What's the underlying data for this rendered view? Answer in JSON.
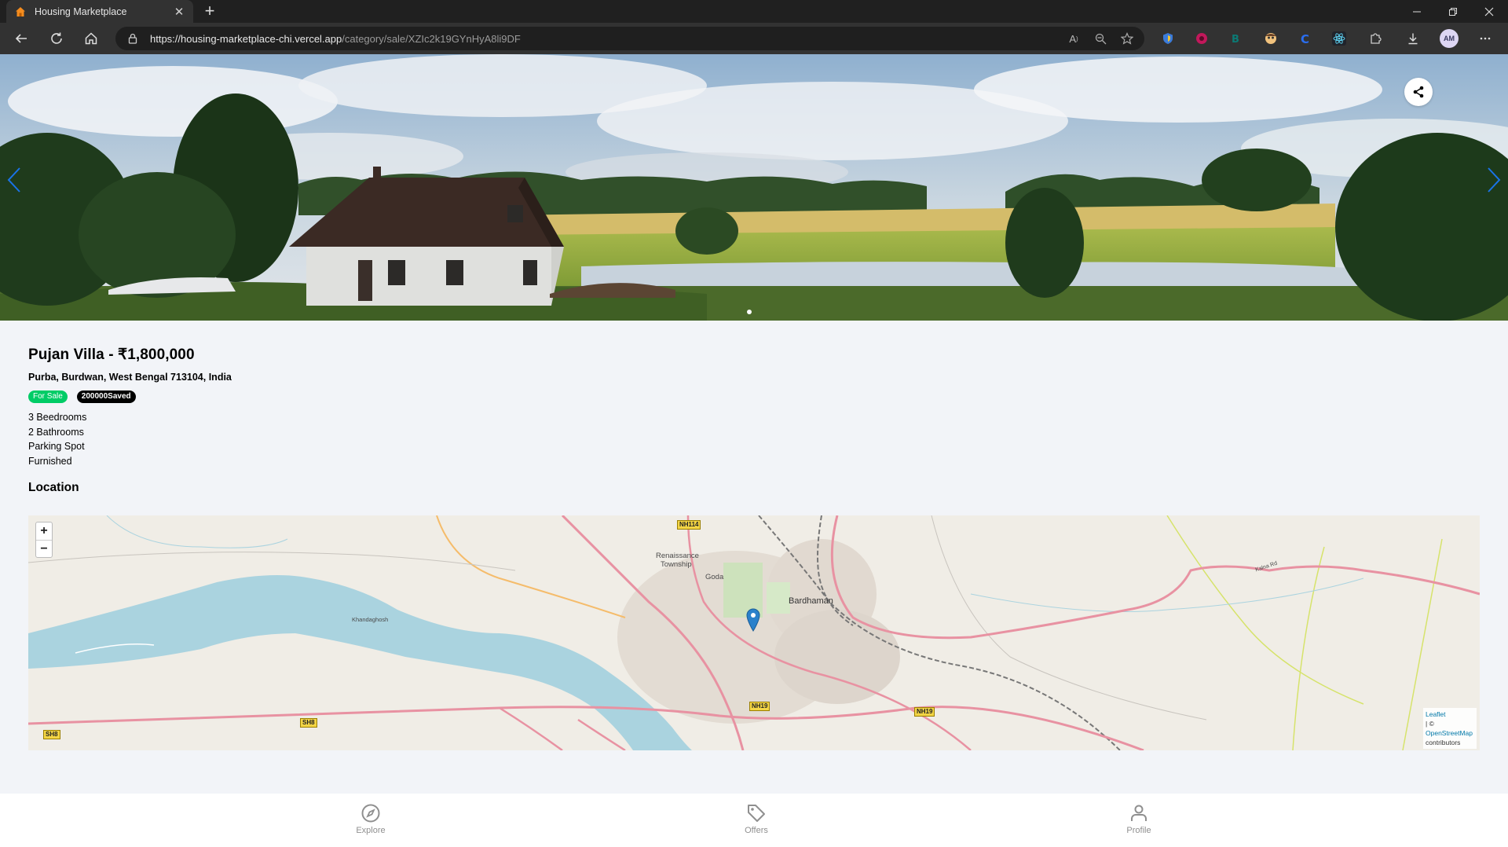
{
  "browser": {
    "tab_title": "Housing Marketplace",
    "url_host": "https://housing-marketplace-chi.vercel.app",
    "url_path": "/category/sale/XZIc2k19GYnHyA8li9DF",
    "profile_initials": "AM"
  },
  "listing": {
    "title": "Pujan Villa - ₹1,800,000",
    "address": "Purba, Burdwan, West Bengal 713104, India",
    "badge_type": "For Sale",
    "badge_saved": "200000Saved",
    "features": [
      "3 Beedrooms",
      "2 Bathrooms",
      "Parking Spot",
      "Furnished"
    ],
    "location_heading": "Location"
  },
  "map": {
    "zoom_in": "+",
    "zoom_out": "−",
    "labels": {
      "renaissance": "Renaissance",
      "township": "Township",
      "goda": "Goda",
      "bardhaman": "Bardhaman",
      "khandaghosh": "Khandaghosh",
      "kalna_rd": "Kalna Rd"
    },
    "shields": {
      "nh114": "NH114",
      "nh19_a": "NH19",
      "nh19_b": "NH19",
      "sh8_a": "SH8",
      "sh8_b": "SH8"
    },
    "attribution": {
      "leaflet": "Leaflet",
      "sep": "| ©",
      "osm": "OpenStreetMap",
      "contributors": "contributors"
    }
  },
  "bottom_nav": {
    "explore": "Explore",
    "offers": "Offers",
    "profile": "Profile"
  },
  "colors": {
    "for_sale_badge": "#00cc66",
    "saved_badge": "#000000",
    "page_bg": "#f2f4f8",
    "river": "#aad3df",
    "major_road": "#e892a2"
  }
}
